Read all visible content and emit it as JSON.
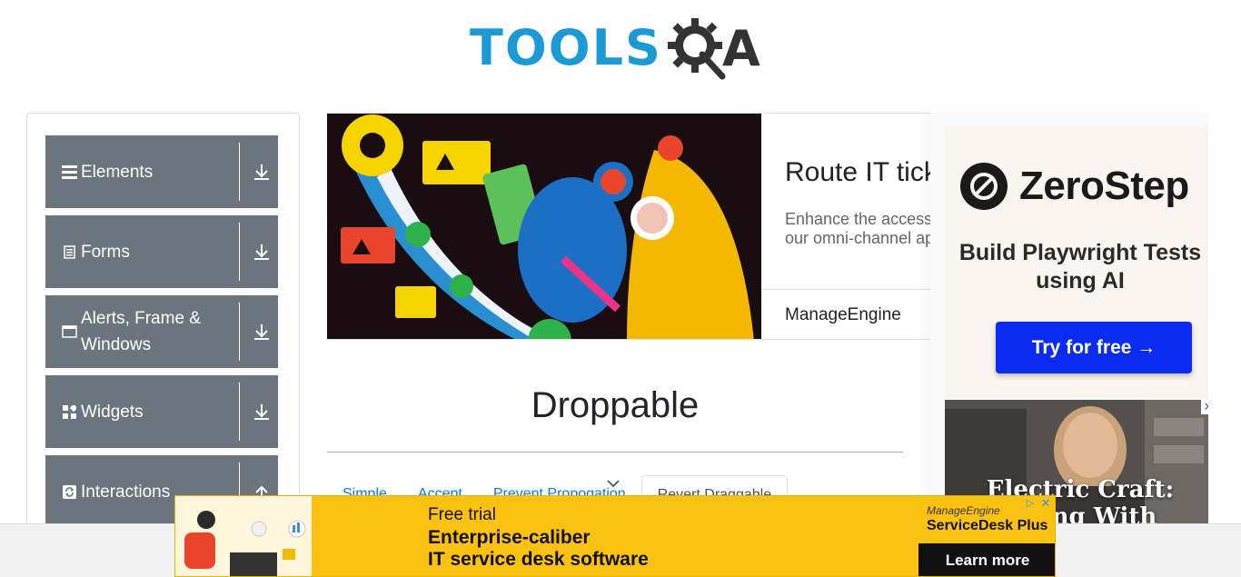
{
  "header": {
    "logo_text": "TOOLS",
    "logo_q": "Q",
    "logo_a": "A"
  },
  "sidebar": {
    "groups": [
      {
        "label": "Elements",
        "icon": "hamburger-icon",
        "arrow": "download-arrow-icon"
      },
      {
        "label": "Forms",
        "icon": "document-icon",
        "arrow": "download-arrow-icon"
      },
      {
        "label": "Alerts, Frame & Windows",
        "icon": "window-icon",
        "arrow": "download-arrow-icon"
      },
      {
        "label": "Widgets",
        "icon": "widgets-grid-icon",
        "arrow": "download-arrow-icon"
      },
      {
        "label": "Interactions",
        "icon": "refresh-icon",
        "arrow": "upload-arrow-icon"
      }
    ]
  },
  "top_ad": {
    "title": "Route IT tick",
    "description": "Enhance the access our omni-channel ap",
    "brand": "ManageEngine"
  },
  "side_ad": {
    "zerostep_name": "ZeroStep",
    "zerostep_tagline": "Build Playwright Tests using AI",
    "zerostep_button": "Try for free →",
    "video_title": "Electric Craft: ...cing With",
    "video_close": "✕"
  },
  "main": {
    "title": "Droppable",
    "tabs": [
      {
        "label": "Simple",
        "active": false
      },
      {
        "label": "Accept",
        "active": false
      },
      {
        "label": "Prevent Propogation",
        "active": false
      },
      {
        "label": "Revert Draggable",
        "active": true
      }
    ]
  },
  "bottom_ad": {
    "trial": "Free trial",
    "headline_line1": "Enterprise-caliber",
    "headline_line2": "IT service desk software",
    "brand_line1": "ManageEngine",
    "brand_line2": "ServiceDesk Plus",
    "button": "Learn more",
    "adchoices": "▷",
    "close": "✕"
  },
  "colors": {
    "brand_blue": "#1b9ad6",
    "sidebar_group_bg": "#6c757d",
    "tab_link": "#007bff",
    "bottom_ad_bg": "#fbc212",
    "zerostep_button": "#0a2cf0"
  }
}
